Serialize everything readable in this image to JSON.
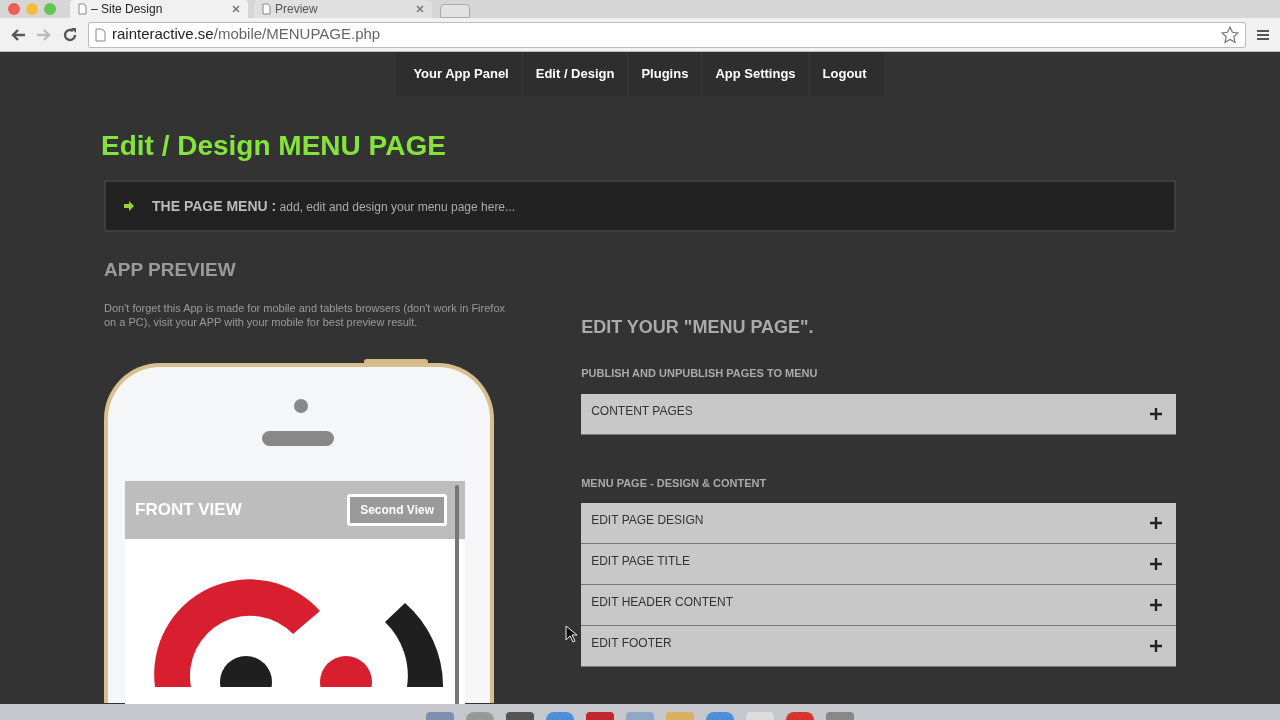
{
  "browser": {
    "tabs": [
      {
        "title": "– Site Design",
        "selected": true
      },
      {
        "title": "Preview",
        "selected": false
      }
    ],
    "url_host": "rainteractive.se",
    "url_path": "/mobile/MENUPAGE.php"
  },
  "nav": {
    "items": [
      {
        "label": "Your App Panel"
      },
      {
        "label": "Edit / Design"
      },
      {
        "label": "Plugins"
      },
      {
        "label": "App Settings"
      },
      {
        "label": "Logout"
      }
    ]
  },
  "page_title": "Edit / Design MENU PAGE",
  "info_bar": {
    "label": "THE PAGE MENU :",
    "text": "add, edit and design your menu page here..."
  },
  "preview": {
    "title": "APP PREVIEW",
    "note": "Don't forget this App is made for mobile and tablets browsers (don't work in Firefox on a PC), visit your APP with your mobile for best preview result.",
    "screen_title": "FRONT VIEW",
    "screen_button": "Second View"
  },
  "editor": {
    "title": "EDIT YOUR \"MENU PAGE\".",
    "sections": [
      {
        "heading": "PUBLISH AND UNPUBLISH PAGES TO MENU",
        "rows": [
          {
            "label": "CONTENT PAGES",
            "expanded": false
          }
        ]
      },
      {
        "heading": "MENU PAGE - DESIGN & CONTENT",
        "rows": [
          {
            "label": "EDIT PAGE DESIGN",
            "expanded": false
          },
          {
            "label": "EDIT PAGE TITLE",
            "expanded": false
          },
          {
            "label": "EDIT HEADER CONTENT",
            "expanded": false
          },
          {
            "label": "EDIT FOOTER",
            "expanded": false
          }
        ]
      }
    ]
  }
}
